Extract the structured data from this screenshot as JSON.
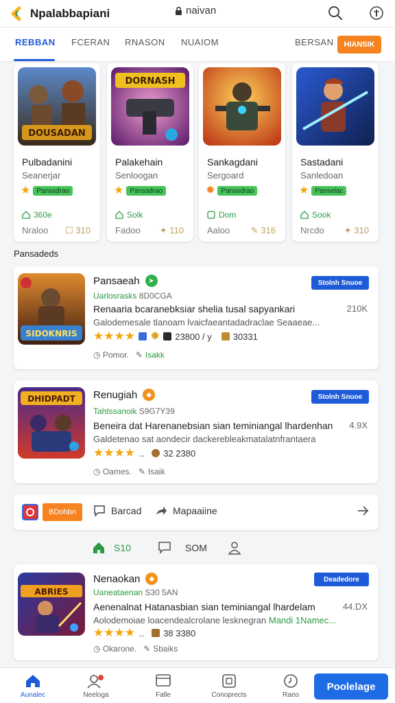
{
  "header": {
    "title": "Npalabbapiani",
    "location": "naivan"
  },
  "tabs": [
    {
      "label": "REBBAN"
    },
    {
      "label": "FCERAN"
    },
    {
      "label": "RNASON"
    },
    {
      "label": "NUAIOM"
    },
    {
      "label": "BERSAN"
    }
  ],
  "tab_cta": "HIANSIK",
  "featured": [
    {
      "name": "Pulbadanini",
      "developer": "Seanerjar",
      "badge": "Panssdrao",
      "downloads": "360e",
      "size": "Nraloo",
      "version": "310",
      "art_title": "DOUSADAN"
    },
    {
      "name": "Palakehain",
      "developer": "Senloogan",
      "badge": "Panssdrao",
      "downloads": "Solk",
      "size": "Fadoo",
      "version": "110",
      "art_title": "DORNASH"
    },
    {
      "name": "Sankagdani",
      "developer": "Sergoard",
      "badge": "Panssdrao",
      "downloads": "Dom",
      "size": "Aaloo",
      "version": "316",
      "art_title": ""
    },
    {
      "name": "Sastadani",
      "developer": "Sanledoan",
      "badge": "Panselac",
      "downloads": "Sook",
      "size": "Nrcdo",
      "version": "310",
      "art_title": ""
    }
  ],
  "section_title": "Pansadeds",
  "list": [
    {
      "name": "Pansaeah",
      "dot_color": "#31b04c",
      "dot_glyph": "P",
      "sub_green": "Uarlosrasks",
      "sub_grey": "8D0CGA",
      "desc": "Renaaria bcaranebksiar shelia tusal sapyankari",
      "desc2": "Galodemesale tlanoam lvaicfaeantadadraclae Seaaeae...",
      "count": "210K",
      "button": "Stolnh Snuoe",
      "rating_text": "23800 / y",
      "rating_text2": "30331",
      "foot_label": "Pomor.",
      "foot_value": "Isakk",
      "art_title": "SIDOKNRIS"
    },
    {
      "name": "Renugiah",
      "dot_color": "#f0921c",
      "dot_glyph": "P",
      "sub_green": "Tahtssanoik",
      "sub_grey": "S9G7Y39",
      "desc": "Beneira dat Harenanebsian sian teminiangal lhardenhan",
      "desc2": "Galdetenao sat aondecir dackerebleakmatalatnfrantaera",
      "count": "4.9X",
      "button": "Stolnh Snuoe",
      "rating_text": "32 2380",
      "rating_text2": "",
      "foot_label": "Oames.",
      "foot_value": "Isaik",
      "art_title": "DHIDPADT"
    },
    {
      "name": "Nenaokan",
      "dot_color": "#f0921c",
      "dot_glyph": "P",
      "sub_green": "Uaneataenan",
      "sub_grey": "S30 5AN",
      "desc": "Aenenalnat Hatanasbian sian teminiangal lhardelam",
      "desc2": "Aolodemoiae loacendealcrolane lesknegran",
      "desc2_hl": "Mandi 1Namec...",
      "count": "44.DX",
      "button": "Deadedore",
      "rating_text": "38 3380",
      "rating_text2": "",
      "foot_label": "Okarone.",
      "foot_value": "Sbaiks",
      "art_title": "ABRIES"
    }
  ],
  "action_bar": {
    "orange_label": "BDohbn",
    "action1": "Barcad",
    "action2": "Mapaaiine"
  },
  "stats": {
    "s1": "S10",
    "s2": "SOM"
  },
  "bottom_nav": [
    {
      "label": "Aunalec"
    },
    {
      "label": "Neeloga"
    },
    {
      "label": "Falle"
    },
    {
      "label": "Conoprects"
    },
    {
      "label": "Raeo"
    }
  ],
  "bottom_cta": "Poolelage",
  "colors": {
    "accent": "#1e5bd8",
    "orange": "#f6831f",
    "green": "#2b9a44",
    "star": "#f2a60c"
  }
}
